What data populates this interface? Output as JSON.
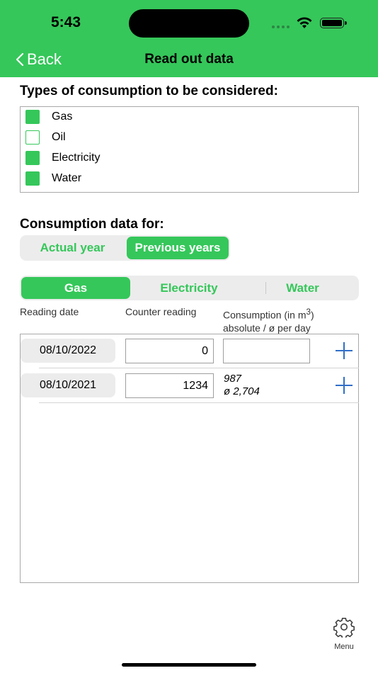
{
  "status": {
    "time": "5:43"
  },
  "nav": {
    "back_label": "Back",
    "title": "Read out data"
  },
  "types_section": {
    "heading": "Types of consumption to be considered:",
    "items": [
      {
        "label": "Gas",
        "checked": true
      },
      {
        "label": "Oil",
        "checked": false
      },
      {
        "label": "Electricity",
        "checked": true
      },
      {
        "label": "Water",
        "checked": true
      }
    ]
  },
  "consumption_section": {
    "heading": "Consumption data for:",
    "year_options": [
      "Actual year",
      "Previous years"
    ],
    "year_selected": "Previous years"
  },
  "type_tabs": {
    "options": [
      "Gas",
      "Electricity",
      "Water"
    ],
    "selected": "Gas"
  },
  "columns": {
    "reading_date": "Reading date",
    "counter_reading": "Counter reading",
    "consumption_line1": "Consumption (in m",
    "consumption_sup": "3",
    "consumption_line1_end": ")",
    "consumption_line2": "absolute / ø per day"
  },
  "rows": [
    {
      "date": "08/10/2022",
      "counter": "0",
      "absolute": "",
      "per_day": ""
    },
    {
      "date": "08/10/2021",
      "counter": "1234",
      "absolute": "987",
      "per_day": "ø 2,704"
    }
  ],
  "menu": {
    "label": "Menu",
    "icon": "gear-icon"
  },
  "colors": {
    "accent": "#35c75a",
    "plus": "#2f6fc8"
  }
}
